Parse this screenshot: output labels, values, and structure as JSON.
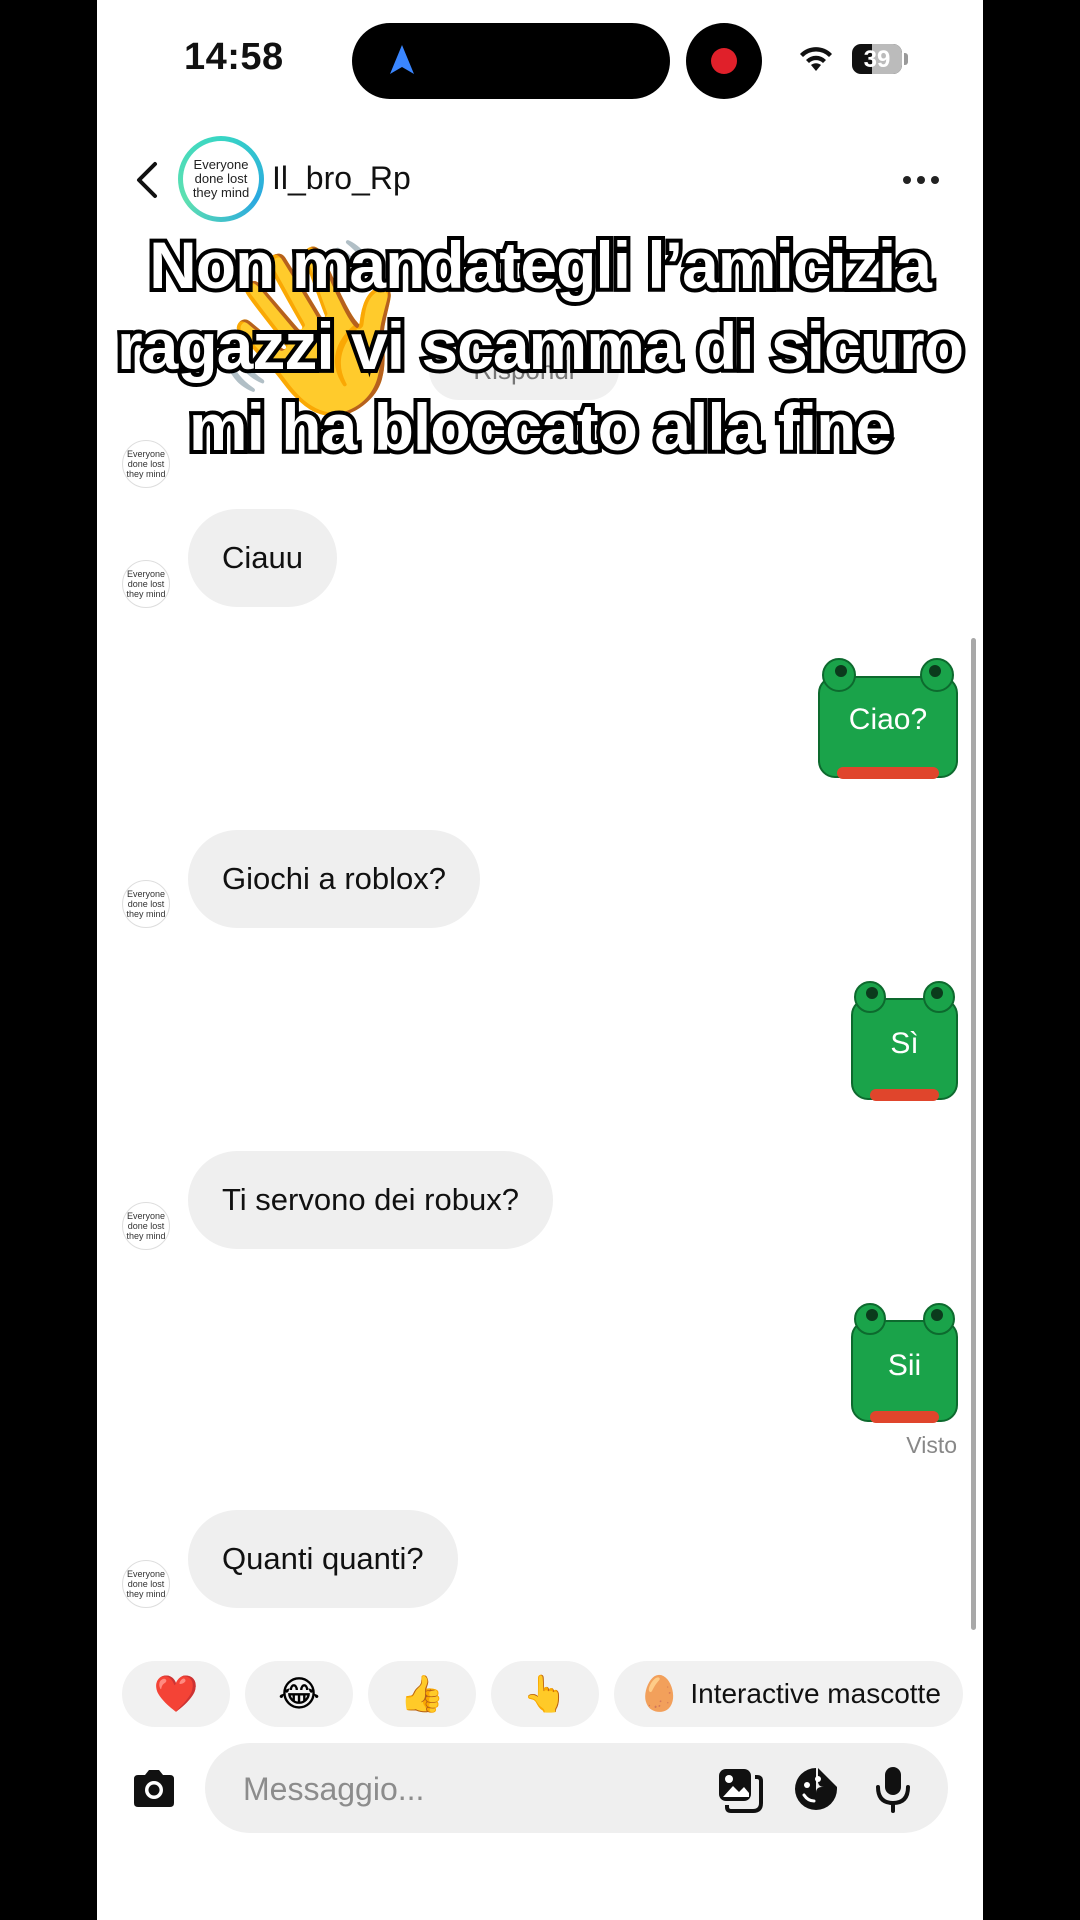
{
  "status_bar": {
    "time": "14:58",
    "battery": "39",
    "icons": [
      "navigation-arrow-icon",
      "recording-dot-icon",
      "wifi-icon",
      "battery-icon"
    ]
  },
  "header": {
    "avatar_text": "Everyone\ndone  lost\nthey mind",
    "username": "Il_bro_Rp",
    "icons": [
      "back-chevron-icon",
      "more-dots-icon"
    ]
  },
  "background": {
    "reply_pill": "Rispondi"
  },
  "overlay_caption": "Non mandategli l’amicizia\nragazzi vi scamma di sicuro\nmi ha bloccato alla fine",
  "messages": [
    {
      "sender": "them",
      "text": "Ciauu"
    },
    {
      "sender": "me",
      "text": "Ciao?"
    },
    {
      "sender": "them",
      "text": "Giochi a roblox?"
    },
    {
      "sender": "me",
      "text": "Sì"
    },
    {
      "sender": "them",
      "text": "Ti servono dei robux?"
    },
    {
      "sender": "me",
      "text": "Sii"
    },
    {
      "sender": "them",
      "text": "Quanti quanti?"
    }
  ],
  "seen_label": "Visto",
  "quick_reactions": [
    "❤️",
    "😂",
    "👍",
    "👆"
  ],
  "mascot_chip": {
    "emoji": "🥚",
    "label": "Interactive mascotte"
  },
  "composer": {
    "placeholder": "Messaggio...",
    "icons": [
      "camera-icon",
      "gallery-icon",
      "sticker-icon",
      "microphone-icon"
    ]
  },
  "colors": {
    "frog_green": "#1aa34a",
    "frog_mouth": "#e0452c",
    "bubble_gray": "#efefef",
    "avatar_ring": "#38d6c4"
  }
}
